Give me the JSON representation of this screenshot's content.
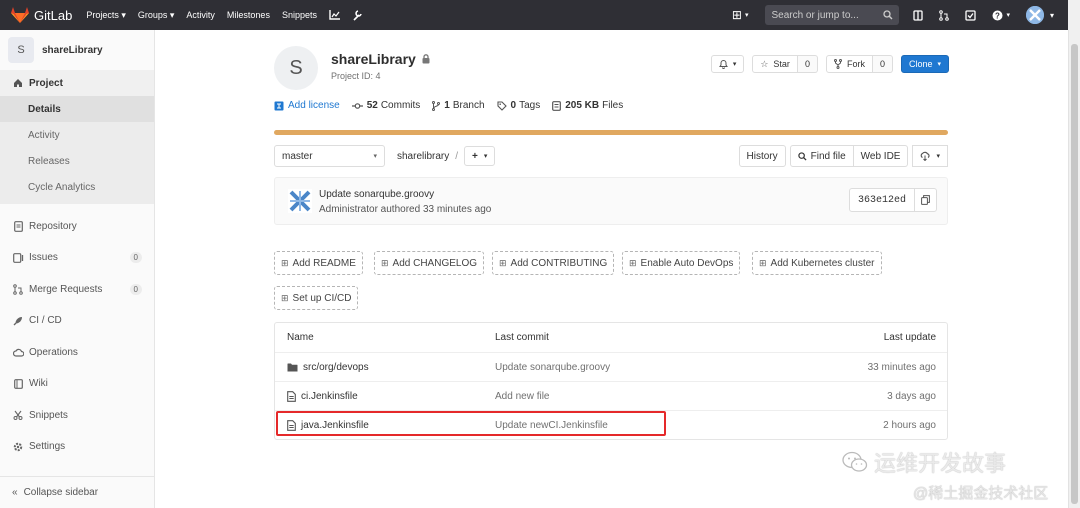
{
  "topnav": {
    "brand": "GitLab",
    "links": [
      "Projects",
      "Groups",
      "Activity",
      "Milestones",
      "Snippets"
    ],
    "search_placeholder": "Search or jump to..."
  },
  "sidebar": {
    "project_initial": "S",
    "project_name": "shareLibrary",
    "section_project": "Project",
    "project_sub": [
      "Details",
      "Activity",
      "Releases",
      "Cycle Analytics"
    ],
    "items": [
      {
        "label": "Repository",
        "icon": "doc-icon"
      },
      {
        "label": "Issues",
        "icon": "issues-icon",
        "count": "0"
      },
      {
        "label": "Merge Requests",
        "icon": "merge-icon",
        "count": "0"
      },
      {
        "label": "CI / CD",
        "icon": "rocket-icon"
      },
      {
        "label": "Operations",
        "icon": "cloud-icon"
      },
      {
        "label": "Wiki",
        "icon": "book-icon"
      },
      {
        "label": "Snippets",
        "icon": "scissors-icon"
      },
      {
        "label": "Settings",
        "icon": "gear-icon"
      }
    ],
    "collapse_label": "Collapse sidebar"
  },
  "project": {
    "initial": "S",
    "title": "shareLibrary",
    "id_label": "Project ID: 4",
    "star_label": "Star",
    "star_count": "0",
    "fork_label": "Fork",
    "fork_count": "0",
    "clone_label": "Clone",
    "add_license": "Add license",
    "commits_count": "52",
    "commits_label": "Commits",
    "branch_count": "1",
    "branch_label": "Branch",
    "tags_count": "0",
    "tags_label": "Tags",
    "files_size": "205 KB",
    "files_label": "Files",
    "language_bar_fraction": 1.0
  },
  "tree": {
    "branch": "master",
    "path": "sharelibrary",
    "add": "+",
    "history": "History",
    "find_file": "Find file",
    "web_ide": "Web IDE"
  },
  "last_commit": {
    "title": "Update sonarqube.groovy",
    "meta": "Administrator authored 33 minutes ago",
    "sha": "363e12ed"
  },
  "quick_actions": [
    "Add README",
    "Add CHANGELOG",
    "Add CONTRIBUTING",
    "Enable Auto DevOps",
    "Add Kubernetes cluster",
    "Set up CI/CD"
  ],
  "files": {
    "headers": [
      "Name",
      "Last commit",
      "Last update"
    ],
    "rows": [
      {
        "name": "src/org/devops",
        "type": "folder",
        "commit": "Update sonarqube.groovy",
        "updated": "33 minutes ago"
      },
      {
        "name": "ci.Jenkinsfile",
        "type": "file",
        "commit": "Add new file",
        "updated": "3 days ago"
      },
      {
        "name": "java.Jenkinsfile",
        "type": "file",
        "commit": "Update newCI.Jenkinsfile",
        "updated": "2 hours ago"
      }
    ]
  },
  "watermark": {
    "line1": "运维开发故事",
    "line2": "@稀土掘金技术社区"
  },
  "colors": {
    "nav_bg": "#2f2f35",
    "accent": "#1f78d1",
    "language_bar": "#e0a860",
    "highlight": "#e5292a"
  }
}
